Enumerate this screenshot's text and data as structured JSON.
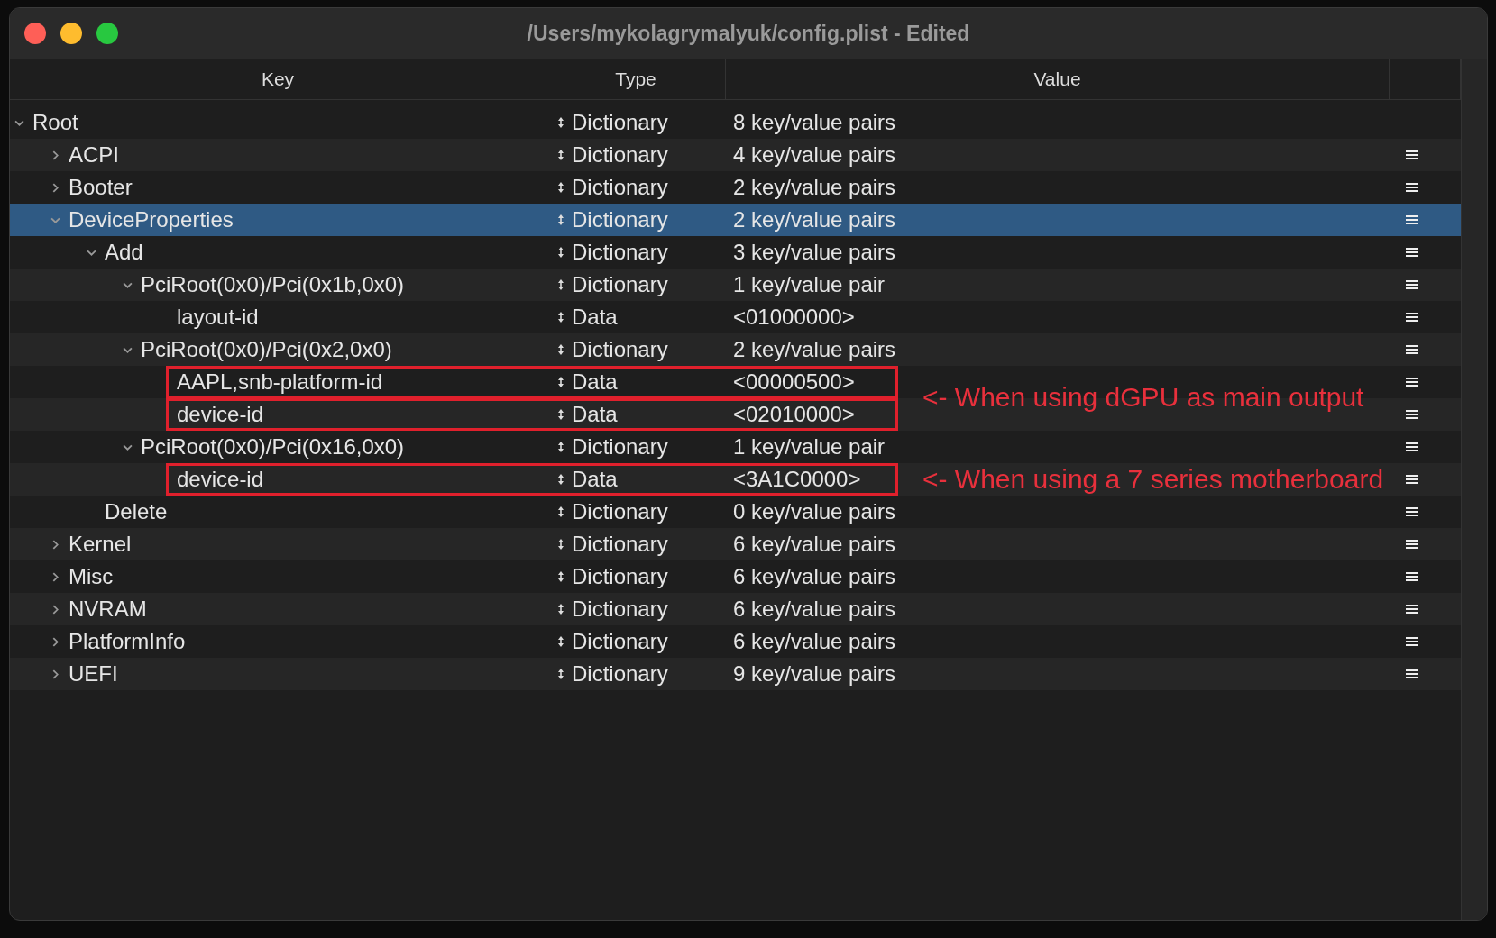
{
  "window": {
    "title": "/Users/mykolagrymalyuk/config.plist - Edited"
  },
  "columns": [
    "Key",
    "Type",
    "Value"
  ],
  "rows": [
    {
      "key": "Root",
      "type": "Dictionary",
      "value": "8 key/value pairs",
      "expanded": true,
      "selected": false,
      "children": [
        {
          "key": "ACPI",
          "type": "Dictionary",
          "value": "4 key/value pairs",
          "expanded": false,
          "selected": false
        },
        {
          "key": "Booter",
          "type": "Dictionary",
          "value": "2 key/value pairs",
          "expanded": false,
          "selected": false
        },
        {
          "key": "DeviceProperties",
          "type": "Dictionary",
          "value": "2 key/value pairs",
          "expanded": true,
          "selected": true,
          "children": [
            {
              "key": "Add",
              "type": "Dictionary",
              "value": "3 key/value pairs",
              "expanded": true,
              "selected": false,
              "children": [
                {
                  "key": "PciRoot(0x0)/Pci(0x1b,0x0)",
                  "type": "Dictionary",
                  "value": "1 key/value pair",
                  "expanded": true,
                  "selected": false,
                  "children": [
                    {
                      "key": "layout-id",
                      "type": "Data",
                      "value": "<01000000>",
                      "selected": false,
                      "highlighted": false
                    }
                  ]
                },
                {
                  "key": "PciRoot(0x0)/Pci(0x2,0x0)",
                  "type": "Dictionary",
                  "value": "2 key/value pairs",
                  "expanded": true,
                  "selected": false,
                  "children": [
                    {
                      "key": "AAPL,snb-platform-id",
                      "type": "Data",
                      "value": "<00000500>",
                      "selected": false,
                      "highlighted": true,
                      "note": "<- When using dGPU as main output"
                    },
                    {
                      "key": "device-id",
                      "type": "Data",
                      "value": "<02010000>",
                      "selected": false,
                      "highlighted": true
                    }
                  ]
                },
                {
                  "key": "PciRoot(0x0)/Pci(0x16,0x0)",
                  "type": "Dictionary",
                  "value": "1 key/value pair",
                  "expanded": true,
                  "selected": false,
                  "children": [
                    {
                      "key": "device-id",
                      "type": "Data",
                      "value": "<3A1C0000>",
                      "selected": false,
                      "highlighted": true,
                      "note": "<- When using a 7 series motherboard"
                    }
                  ]
                }
              ]
            },
            {
              "key": "Delete",
              "type": "Dictionary",
              "value": "0 key/value pairs",
              "selected": false
            }
          ]
        },
        {
          "key": "Kernel",
          "type": "Dictionary",
          "value": "6 key/value pairs",
          "expanded": false,
          "selected": false
        },
        {
          "key": "Misc",
          "type": "Dictionary",
          "value": "6 key/value pairs",
          "expanded": false,
          "selected": false
        },
        {
          "key": "NVRAM",
          "type": "Dictionary",
          "value": "6 key/value pairs",
          "expanded": false,
          "selected": false
        },
        {
          "key": "PlatformInfo",
          "type": "Dictionary",
          "value": "6 key/value pairs",
          "expanded": false,
          "selected": false
        },
        {
          "key": "UEFI",
          "type": "Dictionary",
          "value": "9 key/value pairs",
          "expanded": false,
          "selected": false
        }
      ]
    }
  ]
}
